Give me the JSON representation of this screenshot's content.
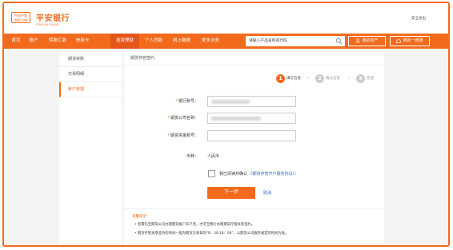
{
  "header": {
    "logo_text": "中国平安\nPING AN",
    "brand_name": "平安银行",
    "brand_en": "PINGAN BANK",
    "logout_label": "安全退出"
  },
  "nav": {
    "items": [
      "首页",
      "账户",
      "转账汇款",
      "信用卡",
      "投资理财",
      "个人贷款",
      "网上缴费",
      "更多业务"
    ],
    "active_index": 4,
    "search_placeholder": "请输入产品名称或代码",
    "my_assets_label": "我的资产",
    "my_overview_label": "我的一账通"
  },
  "sidebar": {
    "items": [
      "期货转账",
      "交易明细",
      "账户管理"
    ],
    "active_index": 2
  },
  "main": {
    "title": "期货存管签约",
    "steps": [
      {
        "num": "1",
        "label": "填写信息",
        "state": "active"
      },
      {
        "num": "2",
        "label": "确认信息",
        "state": "pending"
      },
      {
        "num": "3",
        "label": "完成",
        "state": "pending"
      }
    ],
    "fields": [
      {
        "label": "银行账号",
        "required": true
      },
      {
        "label": "期货公司名称",
        "required": true
      },
      {
        "label": "期货资金账号",
        "required": true
      }
    ],
    "currency_label": "币种",
    "currency_value": "人民币",
    "agree_text": "我已阅读并确认",
    "agree_link": "《期货存管开户服务协议》",
    "next_label": "下一步",
    "cancel_label": "取消"
  },
  "tips": {
    "title": "温馨提示",
    "items": [
      "• 您需先至期货公司办理期货账户开户后，才可至我行办理期货存管关系签约。",
      "• 期货存管关系签约的时间一般为期货交易日的“8：30-16：00”，以期货公司服务规定的时间为准。"
    ]
  },
  "colors": {
    "brand": "#f26b1d",
    "link": "#3366cc"
  }
}
